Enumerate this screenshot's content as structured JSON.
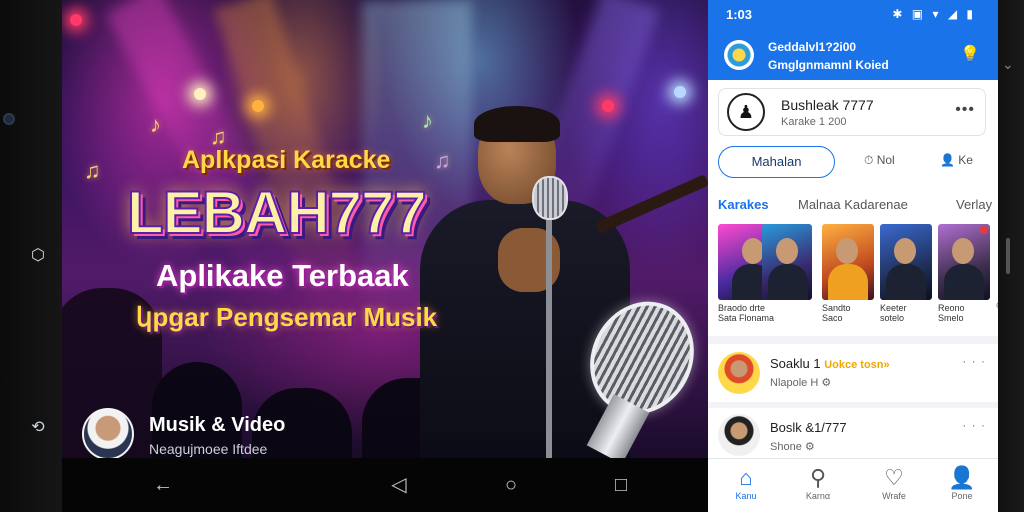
{
  "banner": {
    "title_small": "Aplkpasi Karacke",
    "title_big": "LEBAH777",
    "title_mid": "Aplikake Terbaak",
    "title_sub": "կpgar Pengsemar Musik",
    "chip_title": "Musik & Video",
    "chip_subtitle": "Neagujmoee Iftdee"
  },
  "android_nav": {
    "back_icon": "back-triangle-icon",
    "home_icon": "home-circle-icon",
    "recents_icon": "recents-square-icon"
  },
  "phone": {
    "status": {
      "time": "1:03",
      "icons": "✱ ▣ ▾ ◢ ▮"
    },
    "header": {
      "line1": "Geddalvl1?2i00",
      "line2": "Gmglgnmamnl Koied"
    },
    "profile_card": {
      "name": "Bushleak 7777",
      "subtitle": "Karake 1 200",
      "more": "•••"
    },
    "actions": {
      "primary": "Mahalan",
      "second": "Nol",
      "third": "Ke"
    },
    "tabs": {
      "karaoke": "Karakes",
      "middle": "Malnaa Kadarenae",
      "right": "Verlay"
    },
    "thumbnails": [
      {
        "line1": "Braodo drte",
        "line2": "Sata  Flonama"
      },
      {
        "line1": "",
        "line2": ""
      },
      {
        "line1": "Sandto",
        "line2": "Saco"
      },
      {
        "line1": "Keeter",
        "line2": "sotelo"
      },
      {
        "line1": "Reono",
        "line2": "Smelo"
      }
    ],
    "thumb_overflow": "ov",
    "rows": [
      {
        "name": "Soaklu 1",
        "tag": "Uokce tosn»",
        "sub": "Nlapole H",
        "more": "· · ·"
      },
      {
        "name": "Boslk &1/777",
        "tag": "",
        "sub": "Shone",
        "more": "· · ·"
      }
    ],
    "bottom_nav": [
      {
        "label": "Kanu",
        "icon": "home-icon"
      },
      {
        "label": "Karnα",
        "icon": "search-icon"
      },
      {
        "label": "Wrafe",
        "icon": "heart-icon"
      },
      {
        "label": "Pone",
        "icon": "profile-icon"
      }
    ]
  },
  "colors": {
    "brand_blue": "#1a73e8",
    "banner_gold": "#ffd84a",
    "banner_magenta": "#ff5aa8"
  }
}
